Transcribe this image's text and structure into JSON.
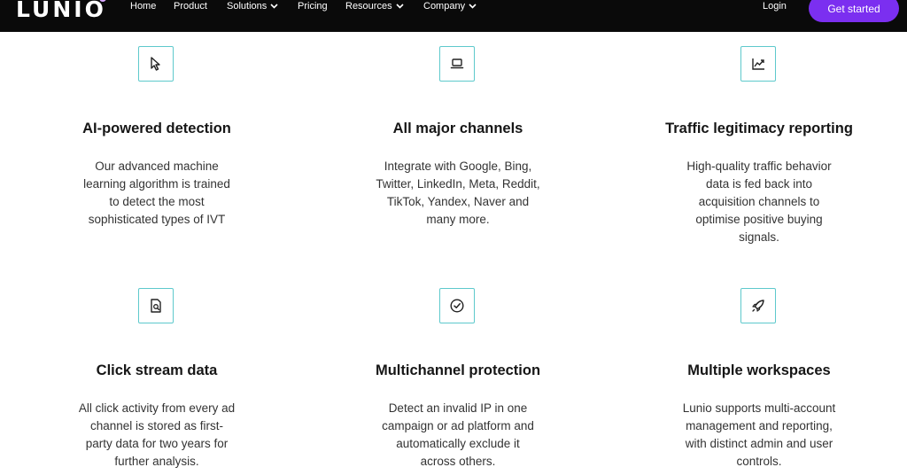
{
  "nav": {
    "logo": "LUNIO",
    "links": [
      {
        "label": "Home",
        "has_dropdown": false
      },
      {
        "label": "Product",
        "has_dropdown": false
      },
      {
        "label": "Solutions",
        "has_dropdown": true
      },
      {
        "label": "Pricing",
        "has_dropdown": false
      },
      {
        "label": "Resources",
        "has_dropdown": true
      },
      {
        "label": "Company",
        "has_dropdown": true
      }
    ],
    "login": "Login",
    "cta": "Get started"
  },
  "colors": {
    "nav_bg": "#0a0a0a",
    "accent": "#7b2ff0",
    "icon_border": "#5ec9cc"
  },
  "features": [
    {
      "icon": "cursor-icon",
      "title": "AI-powered detection",
      "description": "Our advanced machine\nlearning algorithm is trained\nto detect the most\nsophisticated types of IVT"
    },
    {
      "icon": "laptop-icon",
      "title": "All major channels",
      "description": "Integrate with Google, Bing,\nTwitter, LinkedIn, Meta, Reddit,\nTikTok, Yandex, Naver and\nmany more."
    },
    {
      "icon": "trend-chart-icon",
      "title": "Traffic legitimacy reporting",
      "description": "High-quality traffic behavior\ndata is fed back into\nacquisition channels to\noptimise positive buying\nsignals."
    },
    {
      "icon": "document-search-icon",
      "title": "Click stream data",
      "description": "All click activity from every ad\nchannel is stored as first-\nparty data for two years for\nfurther analysis."
    },
    {
      "icon": "check-circle-icon",
      "title": "Multichannel protection",
      "description": "Detect an invalid IP in one\ncampaign or ad platform and\nautomatically exclude it\nacross others."
    },
    {
      "icon": "rocket-icon",
      "title": "Multiple workspaces",
      "description": "Lunio supports multi-account\nmanagement and reporting,\nwith distinct admin and user\ncontrols."
    }
  ]
}
